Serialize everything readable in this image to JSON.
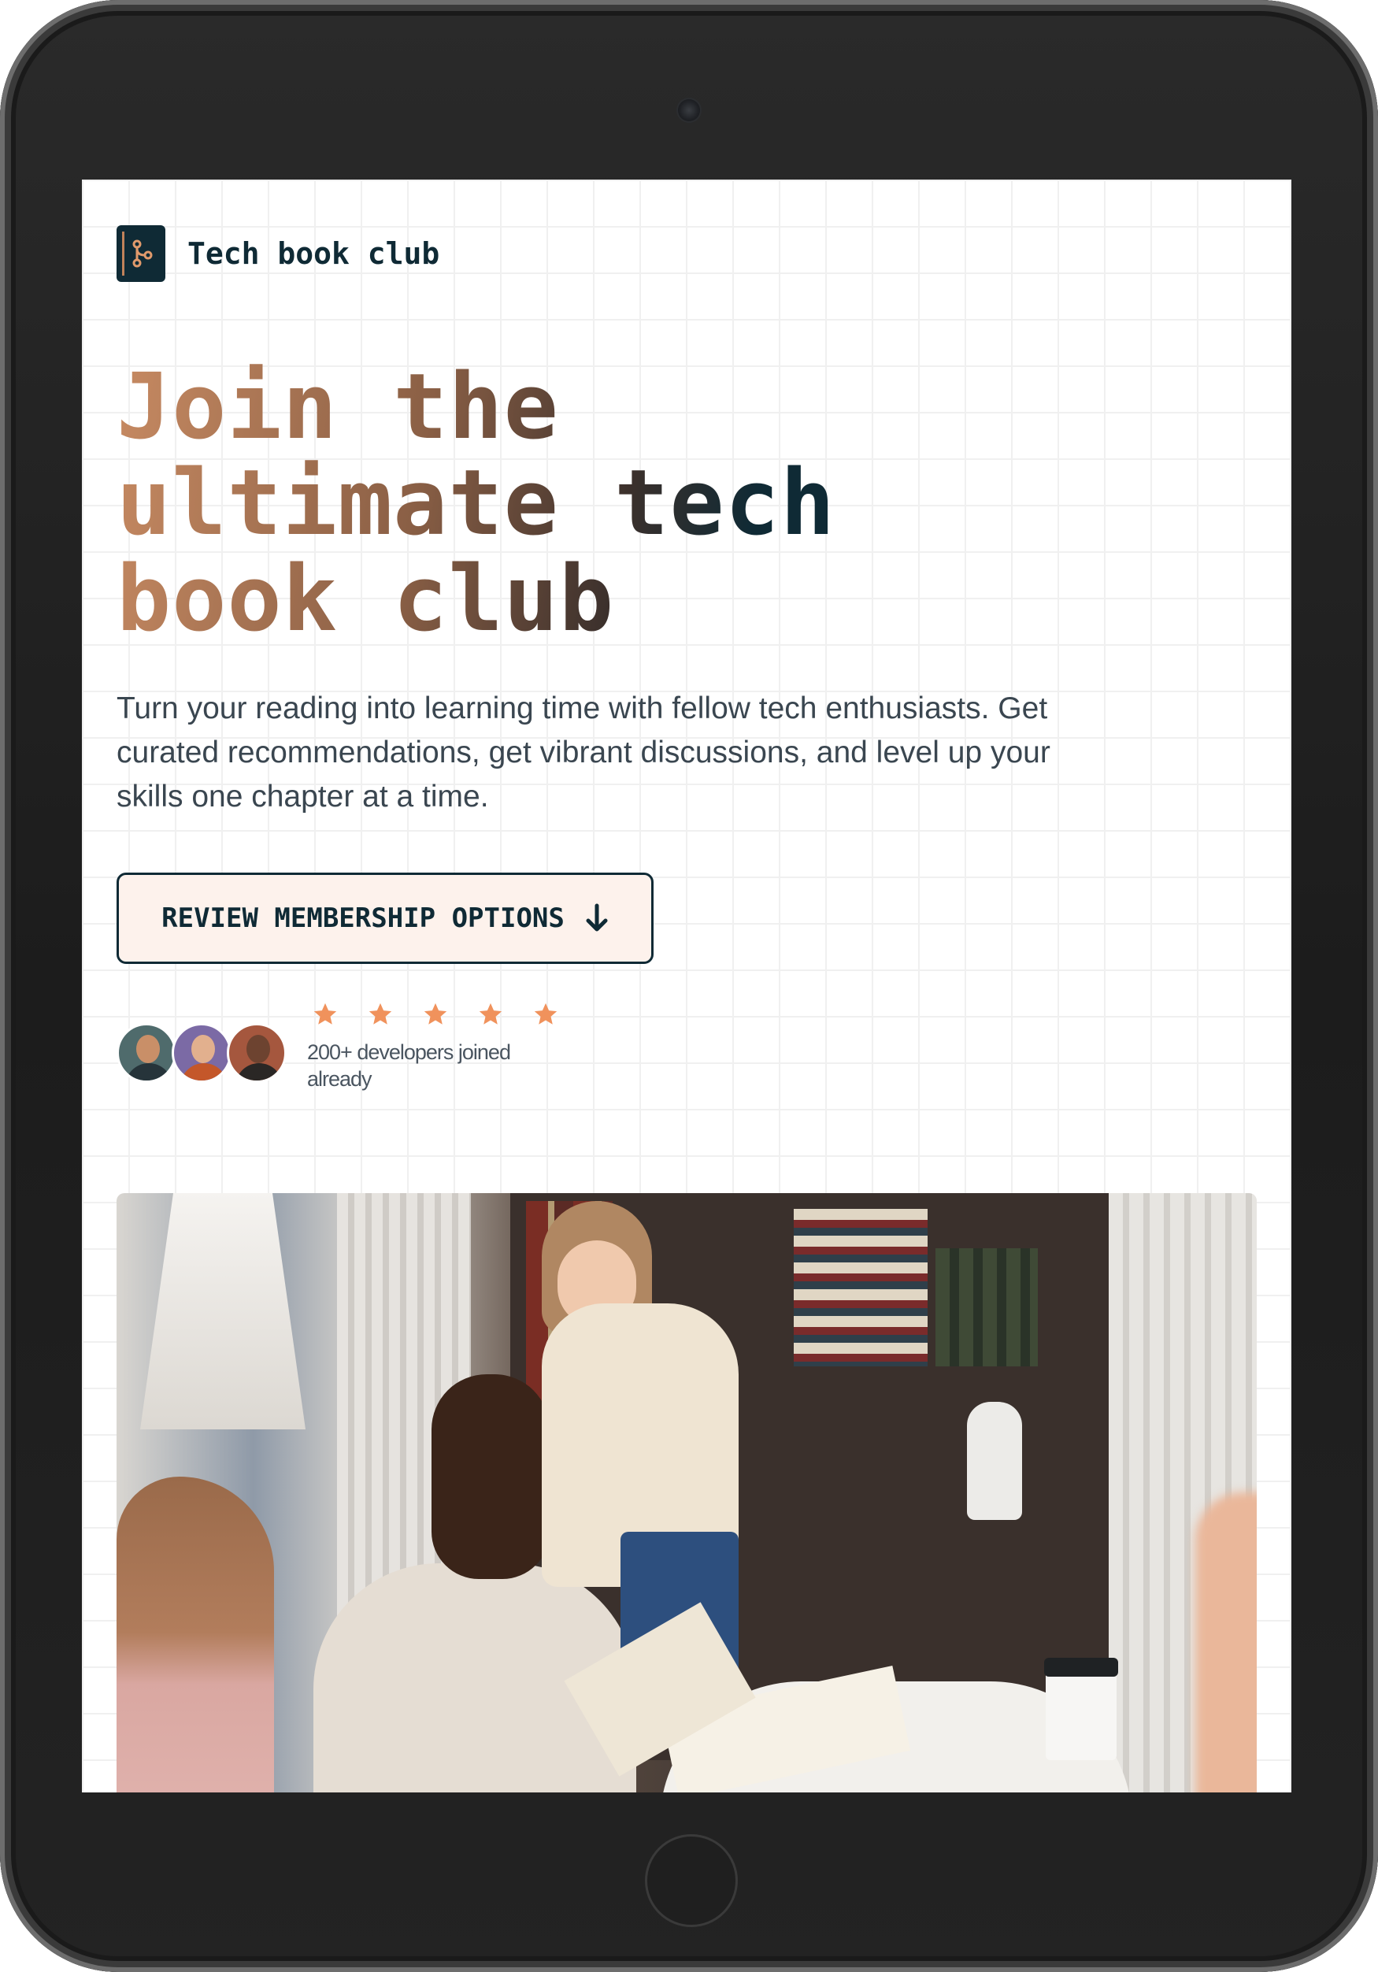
{
  "brand": {
    "name": "Tech book club"
  },
  "hero": {
    "title_line1": "Join the",
    "title_line2": "ultimate tech",
    "title_line3": "book club",
    "lede": "Turn your reading into learning time with fellow tech enthusiasts. Get curated recommendations, get vibrant discussions, and level up your skills one chapter at a time."
  },
  "cta": {
    "label": "REVIEW MEMBERSHIP OPTIONS",
    "icon": "arrow-down-icon"
  },
  "social_proof": {
    "rating": 5,
    "rating_max": 5,
    "caption": "200+ developers joined already",
    "avatars": [
      "developer-avatar-1",
      "developer-avatar-2",
      "developer-avatar-3"
    ]
  },
  "colors": {
    "primary": "#0f2a35",
    "accent": "#c78a62",
    "star": "#f0925c",
    "cta_bg": "#fdf2ec"
  }
}
